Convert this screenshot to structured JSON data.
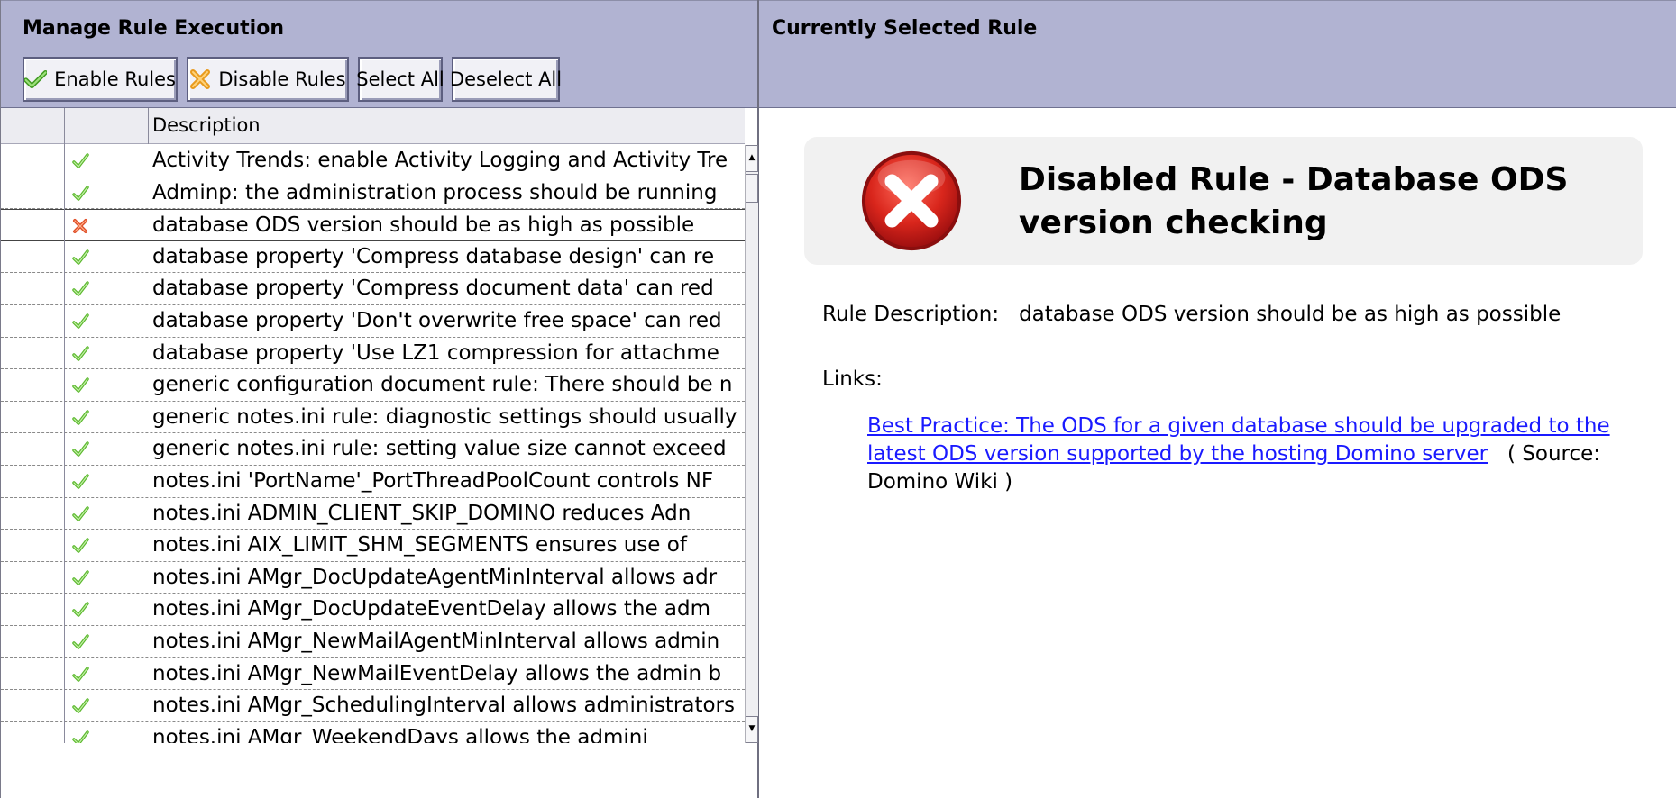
{
  "left_panel": {
    "title": "Manage Rule Execution",
    "toolbar": {
      "enable_label": "Enable Rules",
      "disable_label": "Disable Rules",
      "select_all_label": "Select All",
      "deselect_all_label": "Deselect All"
    },
    "list": {
      "column_header": "Description",
      "rows": [
        {
          "status": "enabled",
          "text": "Activity Trends: enable Activity Logging and Activity Tre"
        },
        {
          "status": "enabled",
          "text": "Adminp: the administration process should be running"
        },
        {
          "status": "disabled",
          "text": "database ODS version should be as high as possible"
        },
        {
          "status": "enabled",
          "text": "database property 'Compress database design' can re"
        },
        {
          "status": "enabled",
          "text": "database property 'Compress document data' can red"
        },
        {
          "status": "enabled",
          "text": "database property 'Don't overwrite free space' can red"
        },
        {
          "status": "enabled",
          "text": "database property 'Use LZ1 compression for attachme"
        },
        {
          "status": "enabled",
          "text": "generic configuration document rule: There should be n"
        },
        {
          "status": "enabled",
          "text": "generic notes.ini rule: diagnostic settings should usually"
        },
        {
          "status": "enabled",
          "text": "generic notes.ini rule: setting value size cannot exceed"
        },
        {
          "status": "enabled",
          "text": "notes.ini 'PortName'_PortThreadPoolCount controls NF"
        },
        {
          "status": "enabled",
          "text": "notes.ini ADMIN_CLIENT_SKIP_DOMINO reduces Adn"
        },
        {
          "status": "enabled",
          "text": "notes.ini AIX_LIMIT_SHM_SEGMENTS ensures use of"
        },
        {
          "status": "enabled",
          "text": "notes.ini AMgr_DocUpdateAgentMinInterval allows adr"
        },
        {
          "status": "enabled",
          "text": "notes.ini AMgr_DocUpdateEventDelay allows the adm"
        },
        {
          "status": "enabled",
          "text": "notes.ini AMgr_NewMailAgentMinInterval allows admin"
        },
        {
          "status": "enabled",
          "text": "notes.ini AMgr_NewMailEventDelay allows the admin b"
        },
        {
          "status": "enabled",
          "text": "notes.ini AMgr_SchedulingInterval allows administrators"
        },
        {
          "status": "enabled",
          "text": "notes.ini AMgr_WeekendDays allows the admini"
        }
      ]
    }
  },
  "right_panel": {
    "title": "Currently Selected Rule",
    "card_title": "Disabled Rule - Database ODS version checking",
    "description_label": "Rule Description:",
    "description_value": "database ODS version should be as high as possible",
    "links_label": "Links:",
    "link_text": "Best Practice: The ODS for a given database should be upgraded to the latest ODS version supported by the hosting Domino server",
    "link_source": "( Source: Domino Wiki )"
  },
  "icons": {
    "enabled": "green-check-icon",
    "disabled": "red-x-icon",
    "card": "error-circle-icon"
  },
  "colors": {
    "header_bg": "#b1b3d2",
    "link": "#1a1aff",
    "enabled": "#5cb82e",
    "disabled": "#e0502a"
  }
}
